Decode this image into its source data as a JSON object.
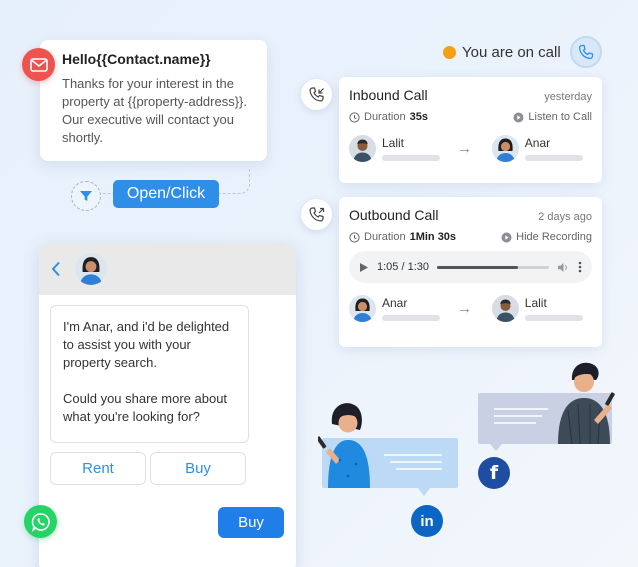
{
  "email": {
    "title": "Hello{{Contact.name}}",
    "body": "Thanks for your interest in the property at {{property-address}}. Our executive will contact you shortly."
  },
  "trigger": {
    "label": "Open/Click"
  },
  "status": {
    "text": "You are on call",
    "dot_color": "#f4a015"
  },
  "inbound": {
    "title": "Inbound Call",
    "time": "yesterday",
    "duration_label": "Duration",
    "duration": "35s",
    "action": "Listen to Call",
    "from": "Lalit",
    "to": "Anar"
  },
  "outbound": {
    "title": "Outbound Call",
    "time": "2 days ago",
    "duration_label": "Duration",
    "duration": "1Min 30s",
    "action": "Hide Recording",
    "player": {
      "position": "1:05 / 1:30",
      "progress": 0.72
    },
    "from": "Anar",
    "to": "Lalit"
  },
  "chat": {
    "message_line1": "I'm Anar, and i'd be delighted to assist you with your property search.",
    "message_line2": "Could you share more about what you're looking for?",
    "options": [
      "Rent",
      "Buy"
    ],
    "sent": "Buy"
  },
  "colors": {
    "accent": "#2f8fe8",
    "email": "#ef5350",
    "whatsapp": "#25d366",
    "linkedin": "#0a66c2",
    "facebook": "#1f4da1"
  }
}
